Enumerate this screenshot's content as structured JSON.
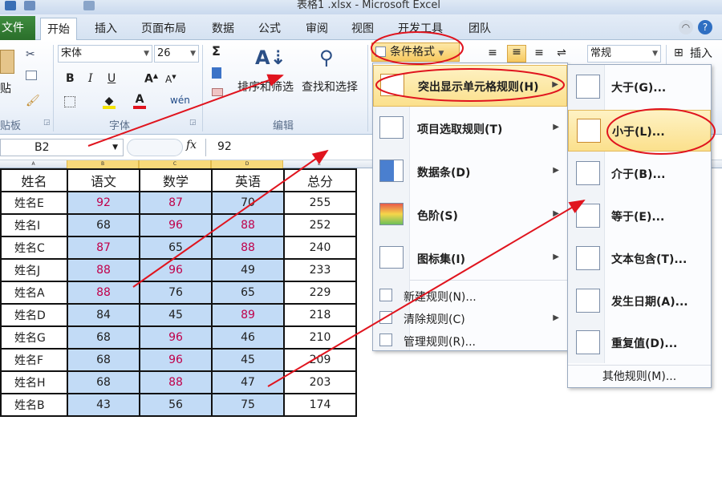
{
  "window": {
    "title": "表格1 .xlsx - Microsoft Excel"
  },
  "tabs": {
    "file": "文件",
    "items": [
      "开始",
      "插入",
      "页面布局",
      "数据",
      "公式",
      "审阅",
      "视图",
      "开发工具",
      "团队"
    ]
  },
  "ribbon": {
    "paste_label": "贴",
    "clipboard_label": "贴板",
    "font_group_label": "字体",
    "font_name": "宋体",
    "font_size": "26",
    "edit_group_label": "编辑",
    "sort_filter_label": "排序和筛选",
    "find_select_label": "查找和选择",
    "conditional_format_label": "条件格式",
    "number_format": "常规",
    "insert_label": "插入",
    "sigma": "Σ",
    "bold": "B",
    "italic": "I",
    "underline": "U"
  },
  "formula_bar": {
    "name_box": "B2",
    "fx": "fx",
    "value": "92"
  },
  "sheet": {
    "column_letters": [
      "A",
      "B",
      "C",
      "D",
      "E"
    ],
    "header": [
      "姓名",
      "语文",
      "数学",
      "英语",
      "总分"
    ],
    "rows": [
      [
        "姓名E",
        "92",
        "87",
        "70",
        "255"
      ],
      [
        "姓名I",
        "68",
        "96",
        "88",
        "252"
      ],
      [
        "姓名C",
        "87",
        "65",
        "88",
        "240"
      ],
      [
        "姓名J",
        "88",
        "96",
        "49",
        "233"
      ],
      [
        "姓名A",
        "88",
        "76",
        "65",
        "229"
      ],
      [
        "姓名D",
        "84",
        "45",
        "89",
        "218"
      ],
      [
        "姓名G",
        "68",
        "96",
        "46",
        "210"
      ],
      [
        "姓名F",
        "68",
        "96",
        "45",
        "209"
      ],
      [
        "姓名H",
        "68",
        "88",
        "47",
        "203"
      ],
      [
        "姓名B",
        "43",
        "56",
        "75",
        "174"
      ]
    ],
    "highlight_color": "#c2dbf6",
    "red_text_color": "#c0004a"
  },
  "cf_menu": {
    "items": [
      {
        "label": "突出显示单元格规则(H)",
        "has_submenu": true
      },
      {
        "label": "项目选取规则(T)",
        "has_submenu": true
      },
      {
        "label": "数据条(D)",
        "has_submenu": true
      },
      {
        "label": "色阶(S)",
        "has_submenu": true
      },
      {
        "label": "图标集(I)",
        "has_submenu": true
      }
    ],
    "commands": [
      {
        "label": "新建规则(N)..."
      },
      {
        "label": "清除规则(C)",
        "has_submenu": true
      },
      {
        "label": "管理规则(R)..."
      }
    ]
  },
  "highlight_submenu": {
    "items": [
      {
        "label": "大于(G)..."
      },
      {
        "label": "小于(L)..."
      },
      {
        "label": "介于(B)..."
      },
      {
        "label": "等于(E)..."
      },
      {
        "label": "文本包含(T)..."
      },
      {
        "label": "发生日期(A)..."
      },
      {
        "label": "重复值(D)..."
      }
    ],
    "more": "其他规则(M)..."
  },
  "annotation_color": "#e0141e"
}
